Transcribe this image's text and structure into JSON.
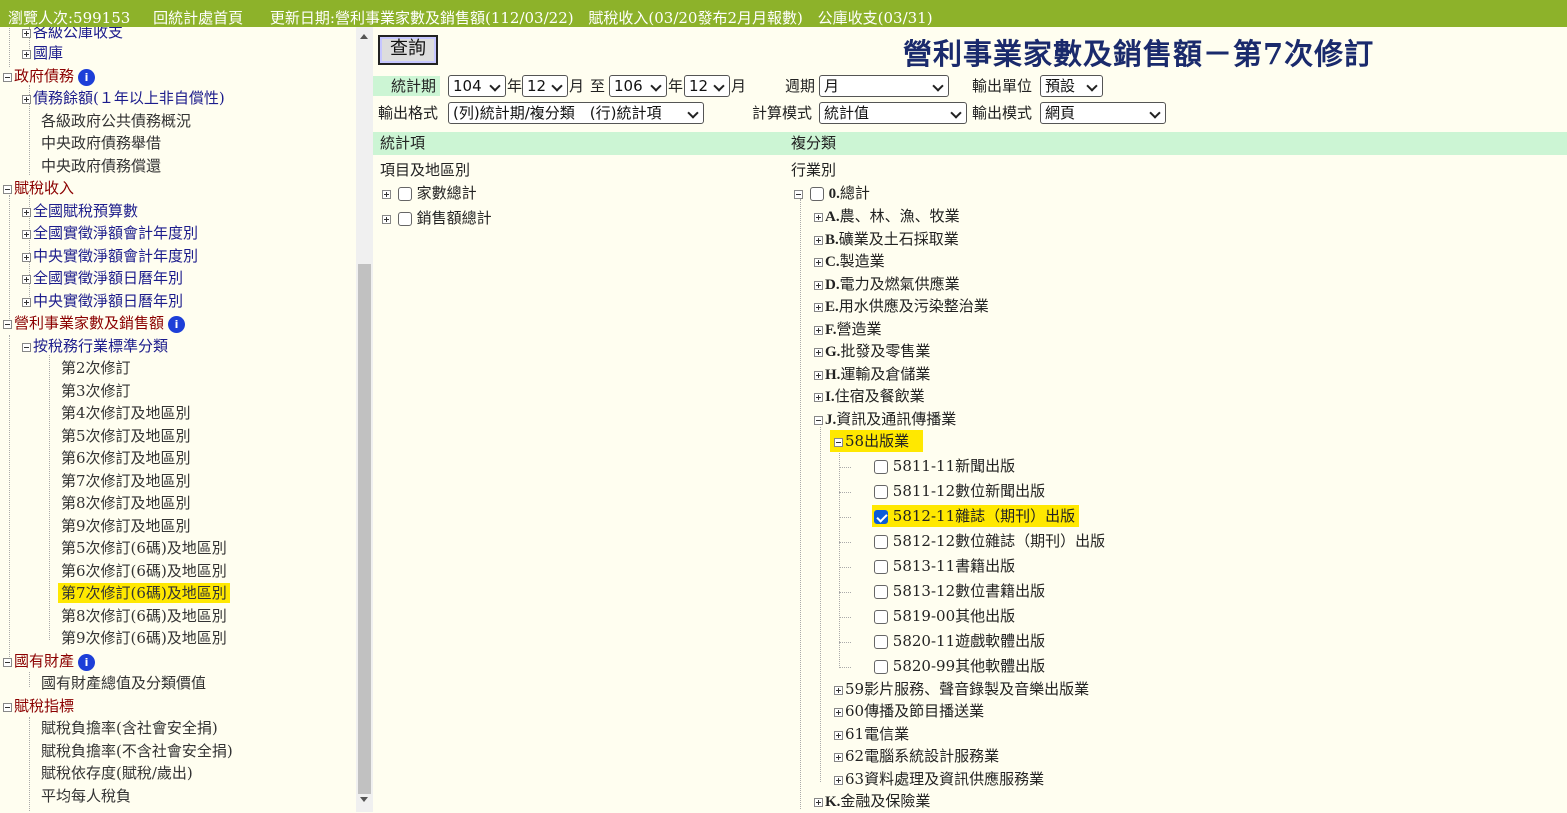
{
  "topbar": {
    "visitors": "瀏覽人次:599153",
    "home_link": "回統計處首頁",
    "update_prefix": "更新日期:",
    "update_1": "營利事業家數及銷售額(112/03/22)",
    "update_2": "賦稅收入(03/20發布2月月報數)",
    "update_3": "公庫收支(03/31)"
  },
  "sidebar": {
    "items": [
      {
        "label": "各級公庫收支"
      },
      {
        "label": "國庫"
      },
      {
        "label": "政府債務"
      },
      {
        "label": "債務餘額(１年以上非自償性)"
      },
      {
        "label": "各級政府公共債務概況"
      },
      {
        "label": "中央政府債務舉借"
      },
      {
        "label": "中央政府債務償還"
      },
      {
        "label": "賦稅收入"
      },
      {
        "label": "全國賦稅預算數"
      },
      {
        "label": "全國實徵淨額會計年度別"
      },
      {
        "label": "中央實徵淨額會計年度別"
      },
      {
        "label": "全國實徵淨額日曆年別"
      },
      {
        "label": "中央實徵淨額日曆年別"
      },
      {
        "label": "營利事業家數及銷售額"
      },
      {
        "label": "按稅務行業標準分類"
      },
      {
        "label": "第2次修訂"
      },
      {
        "label": "第3次修訂"
      },
      {
        "label": "第4次修訂及地區別"
      },
      {
        "label": "第5次修訂及地區別"
      },
      {
        "label": "第6次修訂及地區別"
      },
      {
        "label": "第7次修訂及地區別"
      },
      {
        "label": "第8次修訂及地區別"
      },
      {
        "label": "第9次修訂及地區別"
      },
      {
        "label": "第5次修訂(6碼)及地區別"
      },
      {
        "label": "第6次修訂(6碼)及地區別"
      },
      {
        "label": "第7次修訂(6碼)及地區別"
      },
      {
        "label": "第8次修訂(6碼)及地區別"
      },
      {
        "label": "第9次修訂(6碼)及地區別"
      },
      {
        "label": "國有財產"
      },
      {
        "label": "國有財產總值及分類價值"
      },
      {
        "label": "賦稅指標"
      },
      {
        "label": "賦稅負擔率(含社會安全捐)"
      },
      {
        "label": "賦稅負擔率(不含社會安全捐)"
      },
      {
        "label": "賦稅依存度(賦稅/歲出)"
      },
      {
        "label": "平均每人稅負"
      }
    ],
    "info_glyph": "i"
  },
  "main": {
    "query_button": "查詢",
    "title": "營利事業家數及銷售額－第7次修訂",
    "period_label": "統計期",
    "year_from": "104",
    "year_unit": "年",
    "month_from": "12",
    "month_unit": "月",
    "to_label": "至",
    "year_to": "106",
    "month_to": "12",
    "cycle_label": "週期",
    "cycle_value": "月",
    "unit_label": "輸出單位",
    "unit_value": "預設",
    "format_label": "輸出格式",
    "format_value": "(列)統計期/複分類　(行)統計項",
    "calc_label": "計算模式",
    "calc_value": "統計值",
    "output_mode_label": "輸出模式",
    "output_mode_value": "網頁",
    "col_stat_header": "統計項",
    "col_class_header": "複分類",
    "stat_group_label": "項目及地區別",
    "stat_items": [
      "家數總計",
      "銷售額總計"
    ],
    "class_group_label": "行業別",
    "class_tree": [
      {
        "code": "0.",
        "label": "總計"
      },
      {
        "code": "A.",
        "label": "農、林、漁、牧業"
      },
      {
        "code": "B.",
        "label": "礦業及土石採取業"
      },
      {
        "code": "C.",
        "label": "製造業"
      },
      {
        "code": "D.",
        "label": "電力及燃氣供應業"
      },
      {
        "code": "E.",
        "label": "用水供應及污染整治業"
      },
      {
        "code": "F.",
        "label": "營造業"
      },
      {
        "code": "G.",
        "label": "批發及零售業"
      },
      {
        "code": "H.",
        "label": "運輸及倉儲業"
      },
      {
        "code": "I.",
        "label": "住宿及餐飲業"
      },
      {
        "code": "J.",
        "label": "資訊及通訊傳播業"
      },
      {
        "code": "58",
        "label": "出版業"
      },
      {
        "code": "5811-11",
        "label": "新聞出版"
      },
      {
        "code": "5811-12",
        "label": "數位新聞出版"
      },
      {
        "code": "5812-11",
        "label": "雜誌（期刊）出版"
      },
      {
        "code": "5812-12",
        "label": "數位雜誌（期刊）出版"
      },
      {
        "code": "5813-11",
        "label": "書籍出版"
      },
      {
        "code": "5813-12",
        "label": "數位書籍出版"
      },
      {
        "code": "5819-00",
        "label": "其他出版"
      },
      {
        "code": "5820-11",
        "label": "遊戲軟體出版"
      },
      {
        "code": "5820-99",
        "label": "其他軟體出版"
      },
      {
        "code": "59",
        "label": "影片服務、聲音錄製及音樂出版業"
      },
      {
        "code": "60",
        "label": "傳播及節目播送業"
      },
      {
        "code": "61",
        "label": "電信業"
      },
      {
        "code": "62",
        "label": "電腦系統設計服務業"
      },
      {
        "code": "63",
        "label": "資料處理及資訊供應服務業"
      },
      {
        "code": "K.",
        "label": "金融及保險業"
      }
    ]
  },
  "colors": {
    "topbar": "#8db22a",
    "highlight": "#ffe800",
    "band": "#ccf5d4",
    "category": "#8b0000",
    "link": "#1c1c8c",
    "title": "#1a2a6c"
  },
  "icons": [
    "plus-box-icon",
    "minus-box-icon",
    "info-icon",
    "checkbox-icon",
    "dropdown-chevron-icon",
    "scroll-up-arrow-icon",
    "scroll-down-arrow-icon"
  ]
}
